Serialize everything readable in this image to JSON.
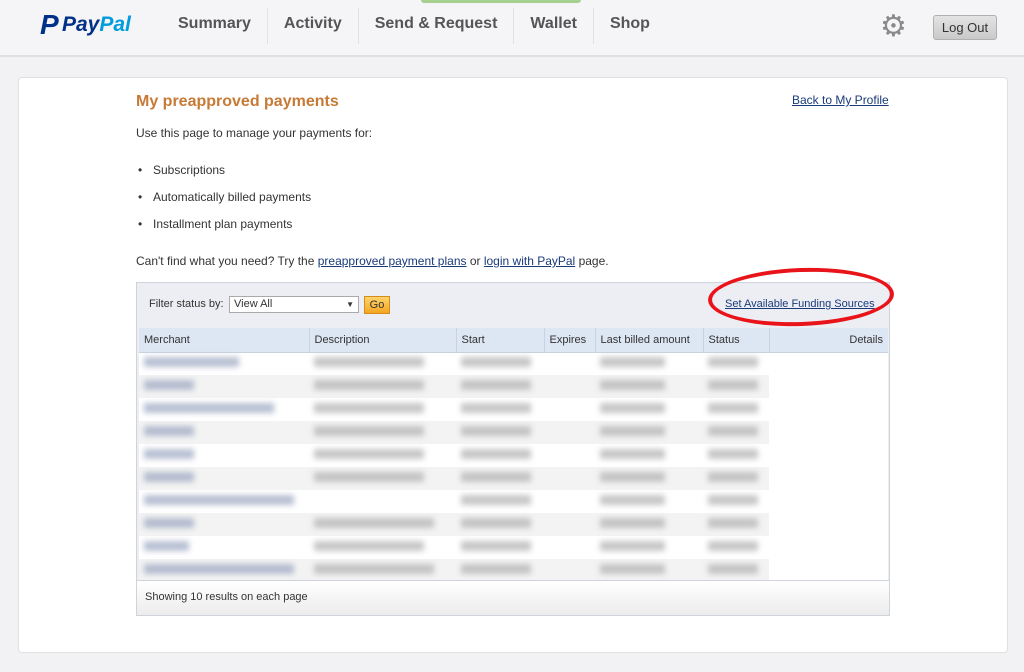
{
  "header": {
    "logo": "PayPal",
    "logo_a": "Pay",
    "logo_b": "Pal",
    "nav": [
      "Summary",
      "Activity",
      "Send & Request",
      "Wallet",
      "Shop"
    ],
    "logout": "Log Out"
  },
  "page": {
    "title": "My preapproved payments",
    "back_link": "Back to My Profile",
    "intro": "Use this page to manage your payments for:",
    "bullets": [
      "Subscriptions",
      "Automatically billed payments",
      "Installment plan payments"
    ],
    "cant_prefix": "Can't find what you need? Try the ",
    "link1": "preapproved payment plans",
    "cant_mid": " or ",
    "link2": "login with PayPal",
    "cant_suffix": " page."
  },
  "filter": {
    "label": "Filter status by:",
    "selected": "View All",
    "go": "Go",
    "funding_link": "Set Available Funding Sources"
  },
  "table": {
    "columns": [
      "Merchant",
      "Description",
      "Start",
      "Expires",
      "Last billed amount",
      "Status",
      "Details"
    ],
    "row_count": 10
  },
  "footer": "Showing 10 results on each page"
}
